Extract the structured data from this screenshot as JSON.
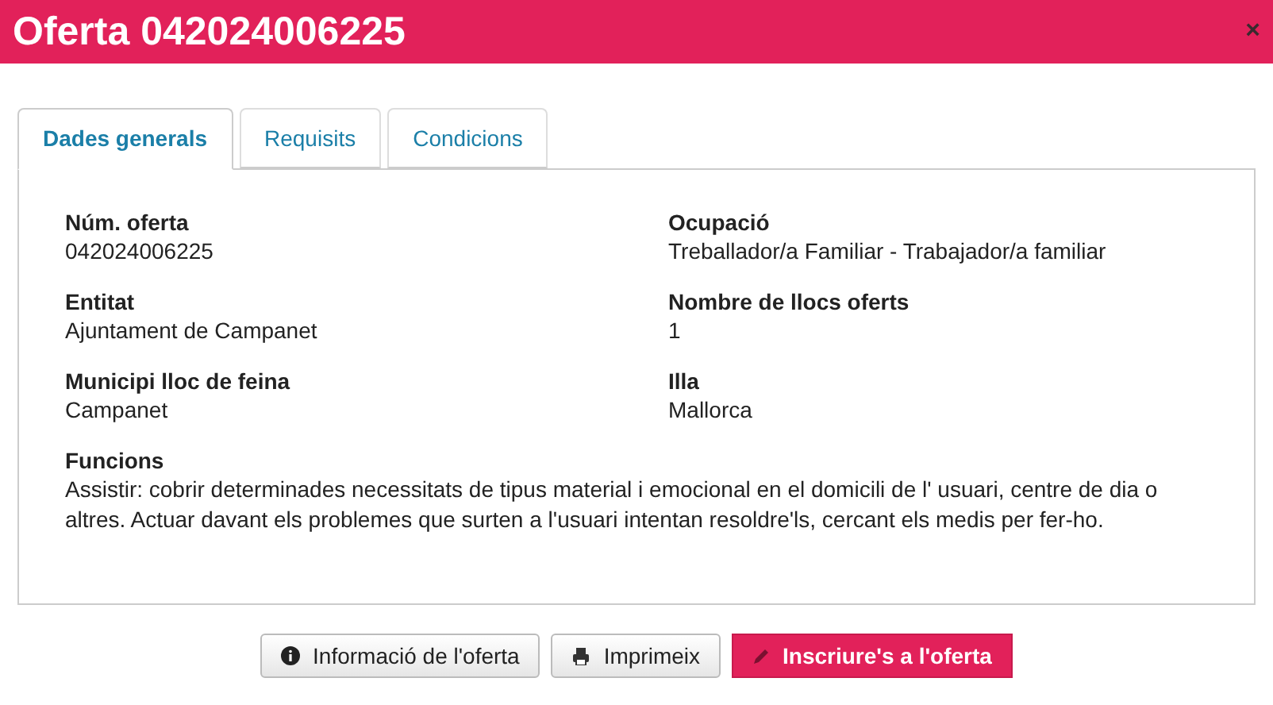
{
  "window": {
    "title": "Oferta 042024006225",
    "close": "×"
  },
  "tabs": [
    {
      "label": "Dades generals",
      "selected": true
    },
    {
      "label": "Requisits",
      "selected": false
    },
    {
      "label": "Condicions",
      "selected": false
    }
  ],
  "fields": [
    {
      "label": "Núm. oferta",
      "value": "042024006225"
    },
    {
      "label": "Ocupació",
      "value": "Treballador/a Familiar - Trabajador/a familiar"
    },
    {
      "label": "Entitat",
      "value": "Ajuntament de Campanet"
    },
    {
      "label": "Nombre de llocs oferts",
      "value": "1"
    },
    {
      "label": "Municipi lloc de feina",
      "value": "Campanet"
    },
    {
      "label": "Illa",
      "value": "Mallorca"
    }
  ],
  "funcions": {
    "label": "Funcions",
    "value": "Assistir: cobrir determinades necessitats de tipus material i emocional en el domicili de l' usuari, centre de dia o altres. Actuar davant els problemes que surten a l'usuari intentan resoldre'ls, cercant els medis per fer-ho."
  },
  "buttons": [
    {
      "label": "Informació de l'oferta",
      "kind": "info"
    },
    {
      "label": "Imprimeix",
      "kind": "print"
    },
    {
      "label": "Inscriure's a l'oferta",
      "kind": "apply"
    }
  ]
}
